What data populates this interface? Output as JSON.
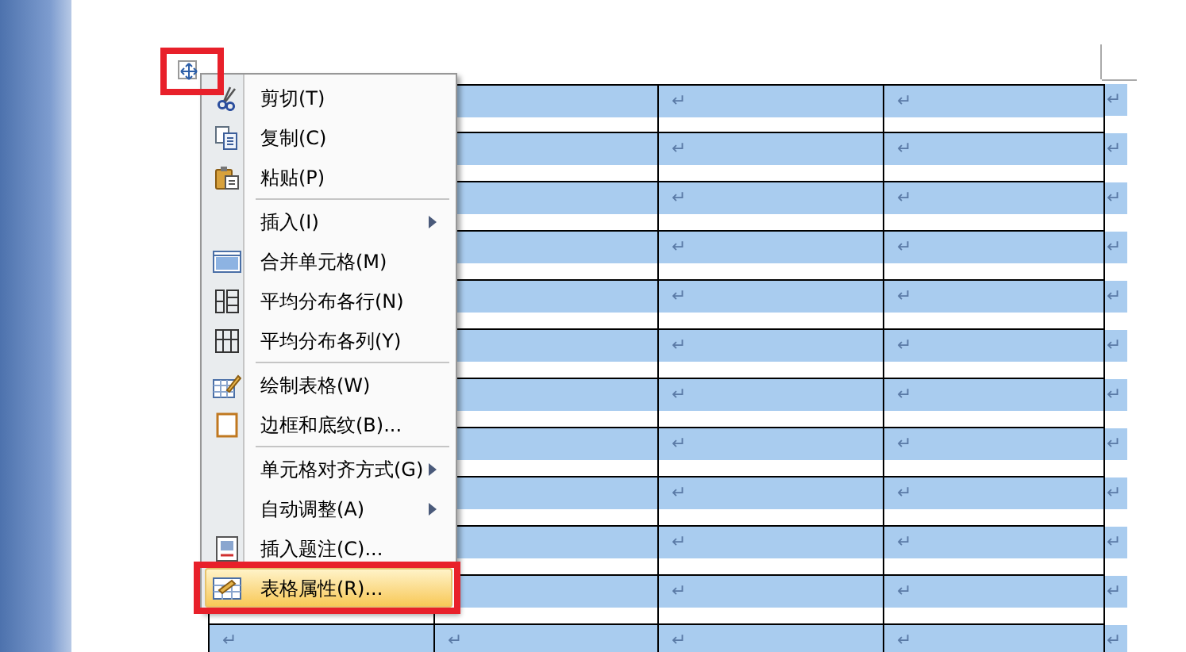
{
  "table": {
    "selected": true,
    "rows": [
      {
        "cells": [
          {},
          {},
          {
            "text": "↵"
          },
          {
            "text": "↵"
          }
        ],
        "end_mark": "↵"
      },
      {
        "cells": [
          {},
          {},
          {
            "text": "↵"
          },
          {
            "text": "↵"
          }
        ],
        "end_mark": "↵"
      },
      {
        "cells": [
          {},
          {},
          {
            "text": "↵"
          },
          {
            "text": "↵"
          }
        ],
        "end_mark": "↵"
      },
      {
        "cells": [
          {},
          {},
          {
            "text": "↵"
          },
          {
            "text": "↵"
          }
        ],
        "end_mark": "↵"
      },
      {
        "cells": [
          {},
          {},
          {
            "text": "↵"
          },
          {
            "text": "↵"
          }
        ],
        "end_mark": "↵"
      },
      {
        "cells": [
          {},
          {},
          {
            "text": "↵"
          },
          {
            "text": "↵"
          }
        ],
        "end_mark": "↵"
      },
      {
        "cells": [
          {},
          {},
          {
            "text": "↵"
          },
          {
            "text": "↵"
          }
        ],
        "end_mark": "↵"
      },
      {
        "cells": [
          {},
          {},
          {
            "text": "↵"
          },
          {
            "text": "↵"
          }
        ],
        "end_mark": "↵"
      },
      {
        "cells": [
          {},
          {},
          {
            "text": "↵"
          },
          {
            "text": "↵"
          }
        ],
        "end_mark": "↵"
      },
      {
        "cells": [
          {},
          {},
          {
            "text": "↵"
          },
          {
            "text": "↵"
          }
        ],
        "end_mark": "↵"
      },
      {
        "cells": [
          {},
          {},
          {
            "text": "↵"
          },
          {
            "text": "↵"
          }
        ],
        "end_mark": "↵"
      },
      {
        "cells": [
          {
            "text": "↵"
          },
          {
            "text": "↵"
          },
          {
            "text": "↵"
          },
          {
            "text": "↵"
          }
        ],
        "end_mark": "↵"
      }
    ]
  },
  "context_menu": {
    "groups": [
      [
        {
          "label": "剪切(T)",
          "submenu": false,
          "highlighted": false
        },
        {
          "label": "复制(C)",
          "submenu": false,
          "highlighted": false
        },
        {
          "label": "粘贴(P)",
          "submenu": false,
          "highlighted": false
        }
      ],
      [
        {
          "label": "插入(I)",
          "submenu": true,
          "highlighted": false
        },
        {
          "label": "合并单元格(M)",
          "submenu": false,
          "highlighted": false
        },
        {
          "label": "平均分布各行(N)",
          "submenu": false,
          "highlighted": false
        },
        {
          "label": "平均分布各列(Y)",
          "submenu": false,
          "highlighted": false
        }
      ],
      [
        {
          "label": "绘制表格(W)",
          "submenu": false,
          "highlighted": false
        },
        {
          "label": "边框和底纹(B)...",
          "submenu": false,
          "highlighted": false
        }
      ],
      [
        {
          "label": "单元格对齐方式(G)",
          "submenu": true,
          "highlighted": false
        },
        {
          "label": "自动调整(A)",
          "submenu": true,
          "highlighted": false
        },
        {
          "label": "插入题注(C)...",
          "submenu": false,
          "highlighted": false
        },
        {
          "label": "表格属性(R)...",
          "submenu": false,
          "highlighted": true
        }
      ]
    ]
  }
}
